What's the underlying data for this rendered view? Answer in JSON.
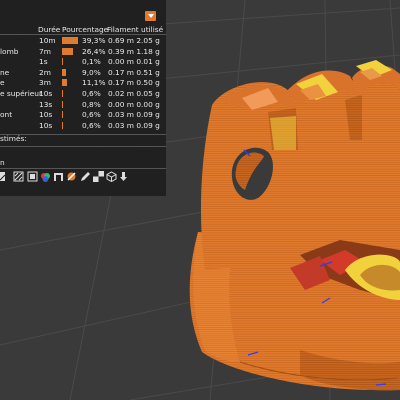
{
  "legend": {
    "columns": [
      "Durée",
      "Pourcentage",
      "Filament utilisé"
    ],
    "rows": [
      {
        "label": "",
        "time": "10m",
        "percent": "39,3%",
        "pct": 39.3,
        "filament": "0.69 m 2.05 g"
      },
      {
        "label": "lomb",
        "time": "7m",
        "percent": "26,4%",
        "pct": 26.4,
        "filament": "0.39 m 1.18 g"
      },
      {
        "label": "",
        "time": "1s",
        "percent": "0,1%",
        "pct": 0.1,
        "filament": "0.00 m 0.01 g"
      },
      {
        "label": "ne",
        "time": "2m",
        "percent": "9,0%",
        "pct": 9.0,
        "filament": "0.17 m 0.51 g"
      },
      {
        "label": "e",
        "time": "3m",
        "percent": "11,1%",
        "pct": 11.1,
        "filament": "0.17 m 0.50 g"
      },
      {
        "label": "e supérieur",
        "time": "10s",
        "percent": "0,6%",
        "pct": 0.6,
        "filament": "0.02 m 0.05 g"
      },
      {
        "label": "",
        "time": "13s",
        "percent": "0,8%",
        "pct": 0.8,
        "filament": "0.00 m 0.00 g"
      },
      {
        "label": "ont",
        "time": "10s",
        "percent": "0,6%",
        "pct": 0.6,
        "filament": "0.03 m 0.09 g"
      },
      {
        "label": "",
        "time": "10s",
        "percent": "0,6%",
        "pct": 0.6,
        "filament": "0.03 m 0.09 g"
      }
    ],
    "estimated_label": "stimés:",
    "bottom_label": "n"
  },
  "toolbar": {
    "icons": [
      "tool-icon-1",
      "tool-icon-2",
      "tool-icon-3",
      "tool-icon-4",
      "tool-icon-5",
      "tool-icon-6",
      "tool-icon-7",
      "tool-icon-8",
      "tool-icon-9"
    ]
  },
  "colors": {
    "accent": "#e07b2e",
    "background": "#3a3a3a",
    "model": "#e07b2e",
    "highlight": "#f2d23c"
  }
}
